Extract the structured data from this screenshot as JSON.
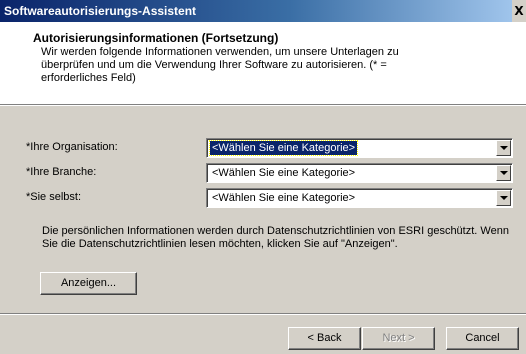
{
  "window": {
    "title": "Softwareautorisierungs-Assistent",
    "close_label": "X"
  },
  "header": {
    "title": "Autorisierungsinformationen (Fortsetzung)",
    "description": "Wir werden folgende Informationen verwenden, um unsere Unterlagen zu überprüfen und um die Verwendung Ihrer Software zu autorisieren. (* = erforderliches Feld)"
  },
  "form": {
    "fields": [
      {
        "label": "*Ihre Organisation:",
        "value": "<Wählen Sie eine Kategorie>",
        "focused": true
      },
      {
        "label": "*Ihre Branche:",
        "value": "<Wählen Sie eine Kategorie>",
        "focused": false
      },
      {
        "label": "*Sie selbst:",
        "value": "<Wählen Sie eine Kategorie>",
        "focused": false
      }
    ]
  },
  "privacy": {
    "text": "Die persönlichen Informationen werden durch Datenschutzrichtlinien von ESRI geschützt. Wenn Sie die Datenschutzrichtlinien lesen möchten, klicken Sie auf \"Anzeigen\".",
    "show_button_label": "Anzeigen..."
  },
  "footer": {
    "back_label": "< Back",
    "next_label": "Next >",
    "cancel_label": "Cancel"
  }
}
